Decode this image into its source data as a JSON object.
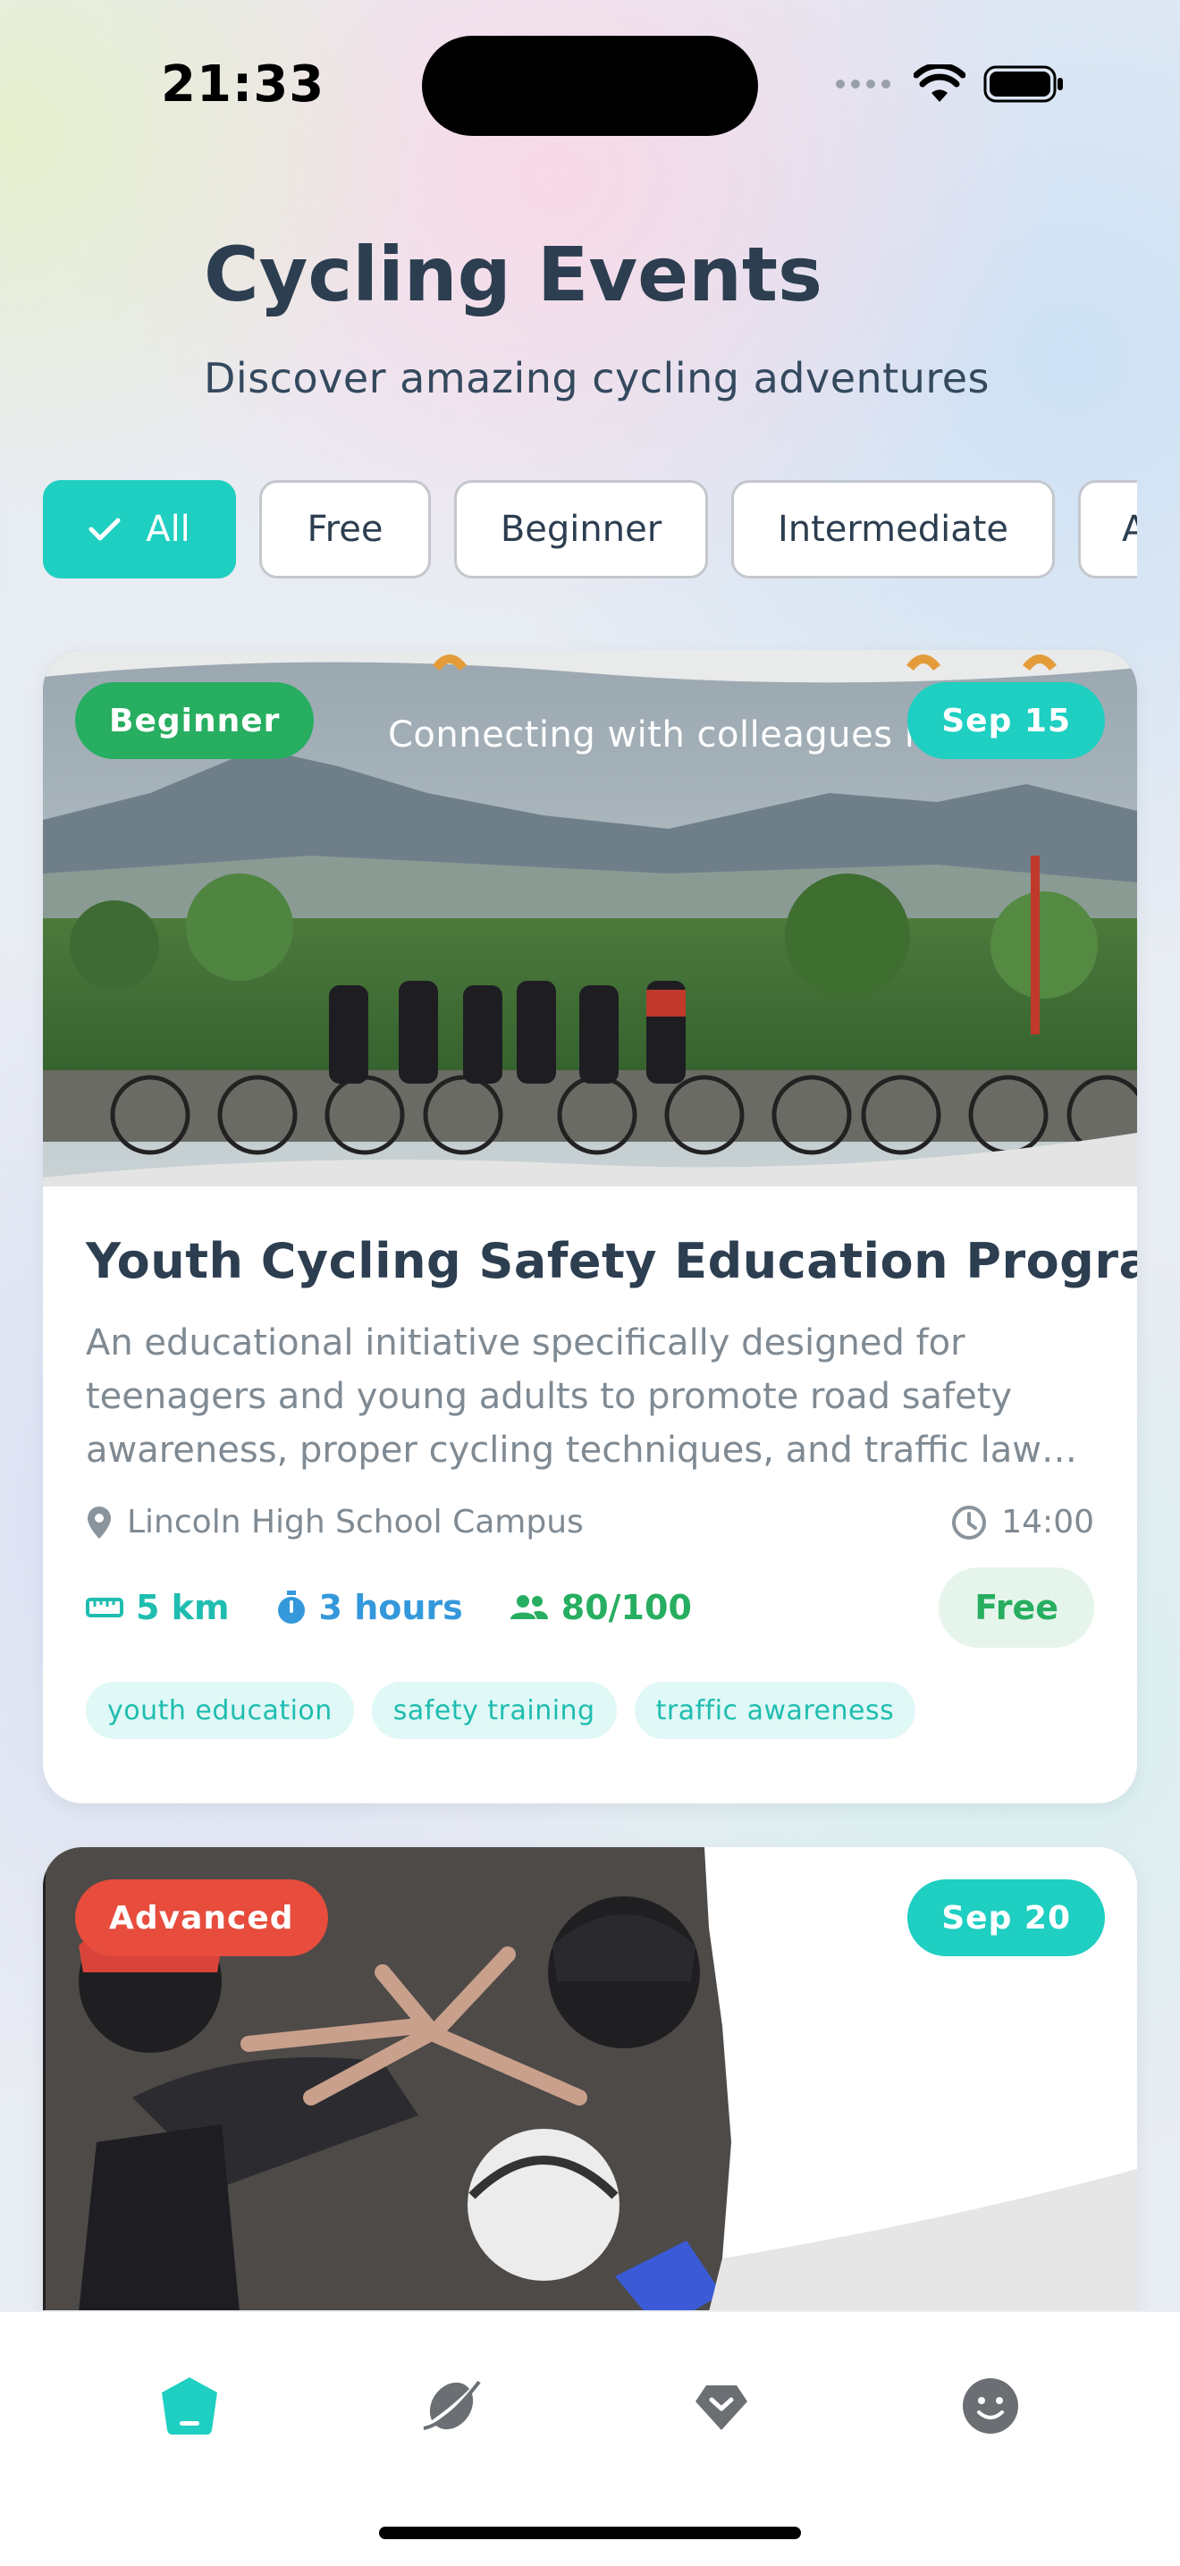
{
  "status_bar": {
    "time": "21:33"
  },
  "header": {
    "title": "Cycling Events",
    "subtitle": "Discover amazing cycling adventures"
  },
  "filters": [
    {
      "label": "All",
      "selected": true
    },
    {
      "label": "Free",
      "selected": false
    },
    {
      "label": "Beginner",
      "selected": false
    },
    {
      "label": "Intermediate",
      "selected": false
    },
    {
      "label": "A",
      "selected": false
    }
  ],
  "events": [
    {
      "level": "Beginner",
      "level_color": "#27ae60",
      "date": "Sep 15",
      "image_overlay_text": "Connecting with colleagues in",
      "title": "Youth Cycling Safety Education Program",
      "description": "An educational initiative specifically designed for teenagers and young adults to promote road safety awareness, proper cycling techniques, and traffic law…",
      "location": "Lincoln High School Campus",
      "time": "14:00",
      "distance": "5 km",
      "duration": "3 hours",
      "participants": "80/100",
      "price": "Free",
      "tags": [
        "youth education",
        "safety training",
        "traffic awareness"
      ]
    },
    {
      "level": "Advanced",
      "level_color": "#e74c3c",
      "date": "Sep 20"
    }
  ],
  "nav": [
    {
      "icon": "home-icon",
      "active": true,
      "color": "#1fcfc1"
    },
    {
      "icon": "planet-explore-icon",
      "active": false
    },
    {
      "icon": "heart-favorites-icon",
      "active": false
    },
    {
      "icon": "profile-smile-icon",
      "active": false
    }
  ],
  "colors": {
    "accent": "#1fcfc1",
    "title": "#2c3e50",
    "free_green": "#27ae60",
    "stat_blue": "#3498db"
  }
}
